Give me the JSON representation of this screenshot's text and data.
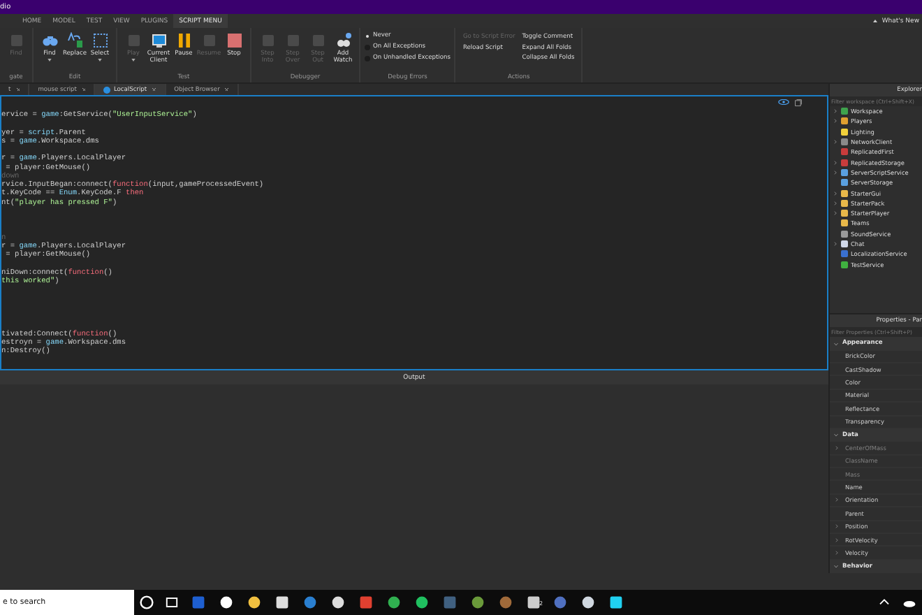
{
  "window": {
    "title": "dio"
  },
  "menu_tabs": [
    {
      "label": "HOME",
      "selected": false
    },
    {
      "label": "MODEL",
      "selected": false
    },
    {
      "label": "TEST",
      "selected": false
    },
    {
      "label": "VIEW",
      "selected": false
    },
    {
      "label": "PLUGINS",
      "selected": false
    },
    {
      "label": "SCRIPT MENU",
      "selected": true
    }
  ],
  "whats_new": "What's New",
  "ribbon": [
    {
      "kind": "buttons",
      "label": "gate",
      "buttons": [
        {
          "label": "Find",
          "disabled": true,
          "dropdown": false
        }
      ]
    },
    {
      "kind": "buttons",
      "label": "Edit",
      "buttons": [
        {
          "label": "Find",
          "disabled": false,
          "dropdown": true
        },
        {
          "label": "Replace",
          "disabled": false,
          "dropdown": false
        },
        {
          "label": "Select",
          "disabled": false,
          "dropdown": true
        }
      ]
    },
    {
      "kind": "buttons",
      "label": "Test",
      "buttons": [
        {
          "label": "Play",
          "disabled": true,
          "dropdown": true
        },
        {
          "label": "Current Client",
          "disabled": false,
          "dropdown": false
        },
        {
          "label": "Pause",
          "disabled": false,
          "dropdown": false
        },
        {
          "label": "Resume",
          "disabled": true,
          "dropdown": false
        },
        {
          "label": "Stop",
          "disabled": false,
          "dropdown": false
        }
      ]
    },
    {
      "kind": "buttons",
      "label": "Debugger",
      "buttons": [
        {
          "label": "Step Into",
          "disabled": true,
          "dropdown": false
        },
        {
          "label": "Step Over",
          "disabled": true,
          "dropdown": false
        },
        {
          "label": "Step Out",
          "disabled": true,
          "dropdown": false
        },
        {
          "label": "Add Watch",
          "disabled": false,
          "dropdown": false
        }
      ]
    },
    {
      "kind": "radios",
      "label": "Debug Errors",
      "options": [
        {
          "label": "Never",
          "selected": true
        },
        {
          "label": "On All Exceptions",
          "selected": false
        },
        {
          "label": "On Unhandled Exceptions",
          "selected": false
        }
      ]
    },
    {
      "kind": "commands",
      "label": "Actions",
      "columns": [
        [
          {
            "label": "Go to Script Error",
            "disabled": true
          },
          {
            "label": "Reload Script",
            "disabled": false
          }
        ],
        [
          {
            "label": "Toggle Comment",
            "disabled": false
          },
          {
            "label": "Expand All Folds",
            "disabled": false
          },
          {
            "label": "Collapse All Folds",
            "disabled": false
          }
        ]
      ]
    }
  ],
  "script_tabs": [
    {
      "label": "t",
      "selected": false,
      "script_icon": false
    },
    {
      "label": "mouse script",
      "selected": false,
      "script_icon": false
    },
    {
      "label": "LocalScript",
      "selected": true,
      "script_icon": true
    },
    {
      "label": "Object Browser",
      "selected": false,
      "script_icon": false
    }
  ],
  "code": [
    {
      "kind": "code",
      "segments": [
        {
          "kind": "plain",
          "text": "ervice = "
        },
        {
          "kind": "builtin",
          "text": "game"
        },
        {
          "kind": "plain",
          "text": ":GetService("
        },
        {
          "kind": "string",
          "text": "\"UserInputService\""
        },
        {
          "kind": "plain",
          "text": ")"
        }
      ]
    },
    {
      "kind": "blank"
    },
    {
      "kind": "code",
      "segments": [
        {
          "kind": "plain",
          "text": "yer = "
        },
        {
          "kind": "builtin",
          "text": "script"
        },
        {
          "kind": "plain",
          "text": ".Parent"
        }
      ]
    },
    {
      "kind": "code",
      "segments": [
        {
          "kind": "plain",
          "text": "s = "
        },
        {
          "kind": "builtin",
          "text": "game"
        },
        {
          "kind": "plain",
          "text": ".Workspace.dms"
        }
      ]
    },
    {
      "kind": "blank"
    },
    {
      "kind": "code",
      "segments": [
        {
          "kind": "plain",
          "text": "r = "
        },
        {
          "kind": "builtin",
          "text": "game"
        },
        {
          "kind": "plain",
          "text": ".Players.LocalPlayer"
        }
      ]
    },
    {
      "kind": "code",
      "segments": [
        {
          "kind": "plain",
          "text": " = player:GetMouse()"
        }
      ]
    },
    {
      "kind": "code",
      "segments": [
        {
          "kind": "comment",
          "text": "down"
        }
      ]
    },
    {
      "kind": "code",
      "segments": [
        {
          "kind": "plain",
          "text": "rvice.InputBegan:connect("
        },
        {
          "kind": "keyword",
          "text": "function"
        },
        {
          "kind": "plain",
          "text": "(input,gameProcessedEvent)"
        }
      ]
    },
    {
      "kind": "code",
      "segments": [
        {
          "kind": "plain",
          "text": "t.KeyCode == "
        },
        {
          "kind": "builtin",
          "text": "Enum"
        },
        {
          "kind": "plain",
          "text": ".KeyCode.F "
        },
        {
          "kind": "keyword",
          "text": "then"
        }
      ]
    },
    {
      "kind": "code",
      "segments": [
        {
          "kind": "plain",
          "text": "nt("
        },
        {
          "kind": "string",
          "text": "\"player has pressed F\""
        },
        {
          "kind": "plain",
          "text": ")"
        }
      ]
    },
    {
      "kind": "blank"
    },
    {
      "kind": "blank"
    },
    {
      "kind": "blank"
    },
    {
      "kind": "code",
      "segments": [
        {
          "kind": "comment",
          "text": "n"
        }
      ]
    },
    {
      "kind": "code",
      "segments": [
        {
          "kind": "plain",
          "text": "r = "
        },
        {
          "kind": "builtin",
          "text": "game"
        },
        {
          "kind": "plain",
          "text": ".Players.LocalPlayer"
        }
      ]
    },
    {
      "kind": "code",
      "segments": [
        {
          "kind": "plain",
          "text": " = player:GetMouse()"
        }
      ]
    },
    {
      "kind": "blank"
    },
    {
      "kind": "code",
      "segments": [
        {
          "kind": "plain",
          "text": "niDown:connect("
        },
        {
          "kind": "keyword",
          "text": "function"
        },
        {
          "kind": "plain",
          "text": "()"
        }
      ]
    },
    {
      "kind": "code",
      "segments": [
        {
          "kind": "string",
          "text": "this worked\""
        },
        {
          "kind": "plain",
          "text": ")"
        }
      ]
    },
    {
      "kind": "blank"
    },
    {
      "kind": "blank"
    },
    {
      "kind": "blank"
    },
    {
      "kind": "blank"
    },
    {
      "kind": "blank"
    },
    {
      "kind": "code",
      "segments": [
        {
          "kind": "plain",
          "text": "tivated:Connect("
        },
        {
          "kind": "keyword",
          "text": "function"
        },
        {
          "kind": "plain",
          "text": "()"
        }
      ]
    },
    {
      "kind": "code",
      "segments": [
        {
          "kind": "plain",
          "text": "estroyn = "
        },
        {
          "kind": "builtin",
          "text": "game"
        },
        {
          "kind": "plain",
          "text": ".Workspace.dms"
        }
      ]
    },
    {
      "kind": "code",
      "segments": [
        {
          "kind": "plain",
          "text": "n:Destroy()"
        }
      ]
    }
  ],
  "explorer": {
    "title": "Explorer",
    "filter_placeholder": "Filter workspace (Ctrl+Shift+X)",
    "items": [
      {
        "name": "Workspace",
        "expandable": true,
        "color": "#3fa34d"
      },
      {
        "name": "Players",
        "expandable": true,
        "color": "#e0a030"
      },
      {
        "name": "Lighting",
        "expandable": false,
        "color": "#f2d13b"
      },
      {
        "name": "NetworkClient",
        "expandable": true,
        "color": "#8a8a8a"
      },
      {
        "name": "ReplicatedFirst",
        "expandable": false,
        "color": "#c83c3c"
      },
      {
        "name": "ReplicatedStorage",
        "expandable": true,
        "color": "#c83c3c"
      },
      {
        "name": "ServerScriptService",
        "expandable": true,
        "color": "#5aa0e0"
      },
      {
        "name": "ServerStorage",
        "expandable": false,
        "color": "#5aa0e0"
      },
      {
        "name": "StarterGui",
        "expandable": true,
        "color": "#e8b84a"
      },
      {
        "name": "StarterPack",
        "expandable": true,
        "color": "#e8b84a"
      },
      {
        "name": "StarterPlayer",
        "expandable": true,
        "color": "#e8b84a"
      },
      {
        "name": "Teams",
        "expandable": false,
        "color": "#e8b84a"
      },
      {
        "name": "SoundService",
        "expandable": false,
        "color": "#9a9a9a"
      },
      {
        "name": "Chat",
        "expandable": true,
        "color": "#d0d8e8"
      },
      {
        "name": "LocalizationService",
        "expandable": false,
        "color": "#3a70d0"
      },
      {
        "name": "TestService",
        "expandable": false,
        "color": "#40b040"
      }
    ]
  },
  "properties": {
    "title": "Properties - Par",
    "filter_placeholder": "Filter Properties (Ctrl+Shift+P)",
    "sections": [
      {
        "name": "Appearance",
        "expanded": true,
        "items": [
          {
            "name": "BrickColor",
            "expandable": false,
            "disabled": false
          },
          {
            "name": "CastShadow",
            "expandable": false,
            "disabled": false
          },
          {
            "name": "Color",
            "expandable": false,
            "disabled": false
          },
          {
            "name": "Material",
            "expandable": false,
            "disabled": false
          },
          {
            "name": "Reflectance",
            "expandable": false,
            "disabled": false
          },
          {
            "name": "Transparency",
            "expandable": false,
            "disabled": false
          }
        ]
      },
      {
        "name": "Data",
        "expanded": true,
        "items": [
          {
            "name": "CenterOfMass",
            "expandable": true,
            "disabled": true
          },
          {
            "name": "ClassName",
            "expandable": false,
            "disabled": true
          },
          {
            "name": "Mass",
            "expandable": false,
            "disabled": true
          },
          {
            "name": "Name",
            "expandable": false,
            "disabled": false
          },
          {
            "name": "Orientation",
            "expandable": true,
            "disabled": false
          },
          {
            "name": "Parent",
            "expandable": false,
            "disabled": false
          },
          {
            "name": "Position",
            "expandable": true,
            "disabled": false
          },
          {
            "name": "RotVelocity",
            "expandable": true,
            "disabled": false
          },
          {
            "name": "Velocity",
            "expandable": true,
            "disabled": false
          }
        ]
      },
      {
        "name": "Behavior",
        "expanded": true
      }
    ]
  },
  "output": {
    "title": "Output"
  },
  "taskbar": {
    "search_placeholder": "e to search",
    "badge": "2"
  }
}
